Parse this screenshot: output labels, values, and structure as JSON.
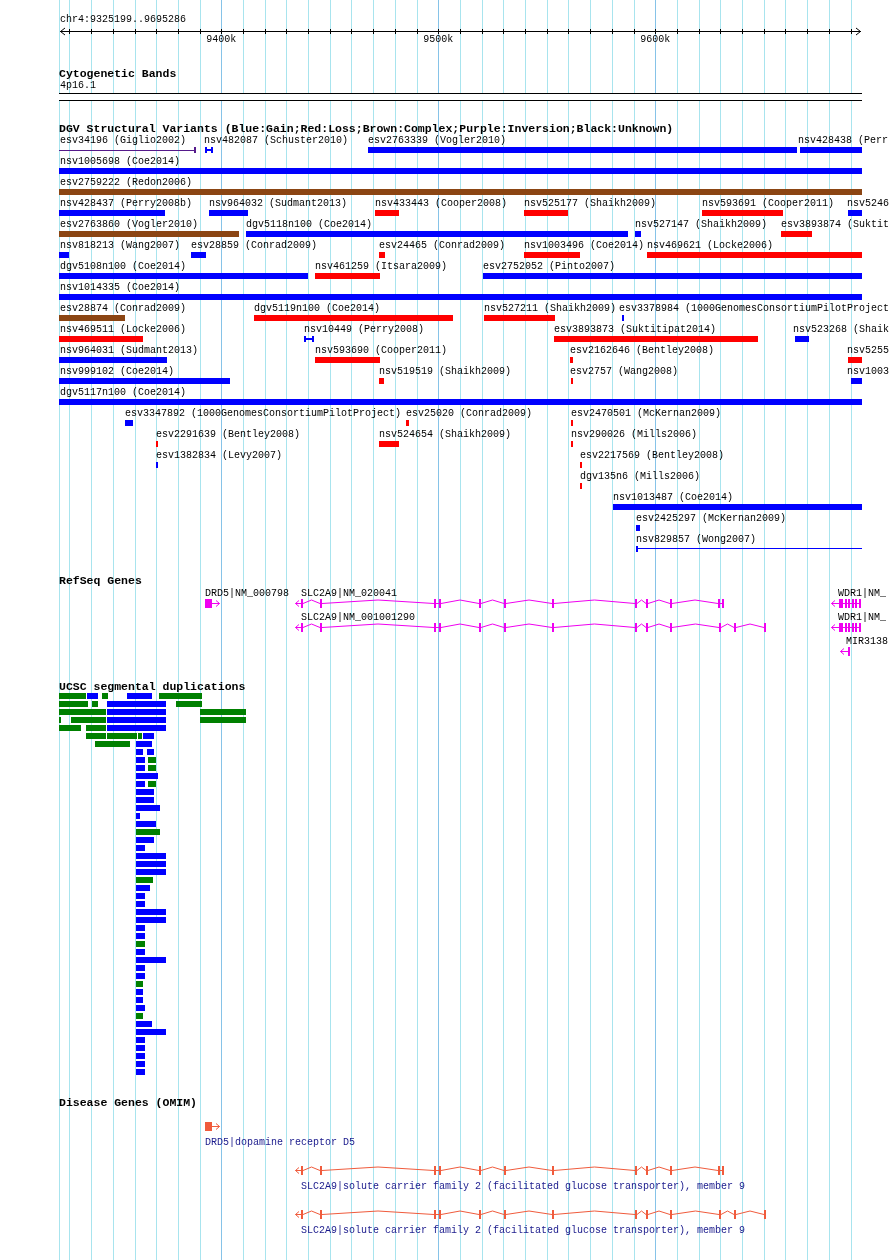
{
  "ruler": {
    "position": "chr4:9325199..9695286",
    "tick_labels": [
      "9400k",
      "9500k",
      "9600k"
    ]
  },
  "cytogenetic_bands": {
    "title": "Cytogenetic Bands",
    "bands": [
      {
        "label": "4p16.1"
      }
    ]
  },
  "dgv_structural_variants": {
    "title": "DGV Structural Variants (Blue:Gain;Red:Loss;Brown:Complex;Purple:Inversion;Black:Unknown)",
    "rows": [
      {
        "features": [
          {
            "label": "esv34196 (Giglio2002)",
            "color": "#551a8b"
          },
          {
            "label": "nsv482087 (Schuster2010)",
            "color": "#0000ff"
          },
          {
            "label": "esv2763339 (Vogler2010)",
            "color": "#0000ff"
          },
          {
            "label": "nsv428438 (Perr",
            "color": "#0000ff"
          }
        ]
      },
      {
        "features": [
          {
            "label": "nsv1005698 (Coe2014)",
            "color": "#0000ff"
          }
        ]
      },
      {
        "features": [
          {
            "label": "esv2759222 (Redon2006)",
            "color": "#8b4513"
          }
        ]
      },
      {
        "features": [
          {
            "label": "nsv428437 (Perry2008b)",
            "color": "#0000ff"
          },
          {
            "label": "nsv964032 (Sudmant2013)",
            "color": "#0000ff"
          },
          {
            "label": "nsv433443 (Cooper2008)",
            "color": "#ff0000"
          },
          {
            "label": "nsv525177 (Shaikh2009)",
            "color": "#ff0000"
          },
          {
            "label": "nsv593691 (Cooper2011)",
            "color": "#ff0000"
          },
          {
            "label": "nsv5246",
            "color": "#0000ff"
          }
        ]
      },
      {
        "features": [
          {
            "label": "esv2763860 (Vogler2010)",
            "color": "#8b4513"
          },
          {
            "label": "dgv5118n100 (Coe2014)",
            "color": "#0000ff"
          },
          {
            "label": "nsv527147 (Shaikh2009)",
            "color": "#0000ff"
          },
          {
            "label": "esv3893874 (Suktit",
            "color": "#ff0000"
          }
        ]
      },
      {
        "features": [
          {
            "label": "nsv818213 (Wang2007)",
            "color": "#0000ff"
          },
          {
            "label": "esv28859 (Conrad2009)",
            "color": "#0000ff"
          },
          {
            "label": "esv24465 (Conrad2009)",
            "color": "#ff0000"
          },
          {
            "label": "nsv1003496 (Coe2014)",
            "color": "#ff0000"
          },
          {
            "label": "nsv469621 (Locke2006)",
            "color": "#ff0000"
          }
        ]
      },
      {
        "features": [
          {
            "label": "dgv5108n100 (Coe2014)",
            "color": "#0000ff"
          },
          {
            "label": "nsv461259 (Itsara2009)",
            "color": "#ff0000"
          },
          {
            "label": "esv2752052 (Pinto2007)",
            "color": "#0000ff"
          }
        ]
      },
      {
        "features": [
          {
            "label": "nsv1014335 (Coe2014)",
            "color": "#0000ff"
          }
        ]
      },
      {
        "features": [
          {
            "label": "esv28874 (Conrad2009)",
            "color": "#8b4513"
          },
          {
            "label": "dgv5119n100 (Coe2014)",
            "color": "#ff0000"
          },
          {
            "label": "nsv527211 (Shaikh2009)",
            "color": "#ff0000"
          },
          {
            "label": "esv3378984 (1000GenomesConsortiumPilotProject",
            "color": "#0000ff"
          }
        ]
      },
      {
        "features": [
          {
            "label": "nsv469511 (Locke2006)",
            "color": "#ff0000"
          },
          {
            "label": "nsv10449 (Perry2008)",
            "color": "#0000ff"
          },
          {
            "label": "esv3893873 (Suktitipat2014)",
            "color": "#ff0000"
          },
          {
            "label": "nsv523268 (Shaik",
            "color": "#0000ff"
          }
        ]
      },
      {
        "features": [
          {
            "label": "nsv964031 (Sudmant2013)",
            "color": "#0000ff"
          },
          {
            "label": "nsv593690 (Cooper2011)",
            "color": "#ff0000"
          },
          {
            "label": "esv2162646 (Bentley2008)",
            "color": "#ff0000"
          },
          {
            "label": "nsv5255",
            "color": "#ff0000"
          }
        ]
      },
      {
        "features": [
          {
            "label": "nsv999102 (Coe2014)",
            "color": "#0000ff"
          },
          {
            "label": "nsv519519 (Shaikh2009)",
            "color": "#ff0000"
          },
          {
            "label": "esv2757 (Wang2008)",
            "color": "#ff0000"
          },
          {
            "label": "nsv1003",
            "color": "#0000ff"
          }
        ]
      },
      {
        "features": [
          {
            "label": "dgv5117n100 (Coe2014)",
            "color": "#0000ff"
          }
        ]
      },
      {
        "features": [
          {
            "label": "esv3347892 (1000GenomesConsortiumPilotProject)",
            "color": "#0000ff"
          },
          {
            "label": "esv25020 (Conrad2009)",
            "color": "#ff0000"
          },
          {
            "label": "esv2470501 (McKernan2009)",
            "color": "#ff0000"
          }
        ]
      },
      {
        "features": [
          {
            "label": "esv2291639 (Bentley2008)",
            "color": "#ff0000"
          },
          {
            "label": "nsv524654 (Shaikh2009)",
            "color": "#ff0000"
          },
          {
            "label": "nsv290026 (Mills2006)",
            "color": "#ff0000"
          }
        ]
      },
      {
        "features": [
          {
            "label": "esv1382834 (Levy2007)",
            "color": "#0000ff"
          },
          {
            "label": "esv2217569 (Bentley2008)",
            "color": "#ff0000"
          }
        ]
      },
      {
        "features": [
          {
            "label": "dgv135n6 (Mills2006)",
            "color": "#ff0000"
          }
        ]
      },
      {
        "features": [
          {
            "label": "nsv1013487 (Coe2014)",
            "color": "#0000ff"
          }
        ]
      },
      {
        "features": [
          {
            "label": "esv2425297 (McKernan2009)",
            "color": "#0000ff"
          }
        ]
      },
      {
        "features": [
          {
            "label": "nsv829857 (Wong2007)",
            "color": "#0000ff"
          }
        ]
      }
    ]
  },
  "refseq_genes": {
    "title": "RefSeq Genes",
    "rows": [
      {
        "genes": [
          {
            "label": "DRD5|NM_000798"
          },
          {
            "label": "SLC2A9|NM_020041"
          },
          {
            "label": "WDR1|NM_"
          }
        ]
      },
      {
        "genes": [
          {
            "label": "SLC2A9|NM_001001290"
          },
          {
            "label": "WDR1|NM_"
          }
        ]
      },
      {
        "genes": [
          {
            "label": "MIR3138"
          }
        ]
      }
    ]
  },
  "segmental_duplications": {
    "title": "UCSC segmental duplications",
    "rows": [
      {
        "items": [
          {
            "color": "#008000"
          },
          {
            "color": "#0000ff"
          },
          {
            "color": "#008000"
          },
          {
            "color": "#0000ff"
          },
          {
            "color": "#008000"
          }
        ]
      },
      {
        "items": [
          {
            "color": "#008000"
          },
          {
            "color": "#008000"
          },
          {
            "color": "#0000ff"
          },
          {
            "color": "#008000"
          }
        ]
      },
      {
        "items": [
          {
            "color": "#008000"
          },
          {
            "color": "#0000ff"
          },
          {
            "color": "#008000"
          }
        ]
      },
      {
        "items": [
          {
            "color": "#008000"
          },
          {
            "color": "#008000"
          },
          {
            "color": "#0000ff"
          },
          {
            "color": "#008000"
          }
        ]
      },
      {
        "items": [
          {
            "color": "#008000"
          },
          {
            "color": "#008000"
          },
          {
            "color": "#0000ff"
          }
        ]
      },
      {
        "items": [
          {
            "color": "#008000"
          },
          {
            "color": "#008000"
          },
          {
            "color": "#008000"
          },
          {
            "color": "#0000ff"
          }
        ]
      },
      {
        "items": [
          {
            "color": "#008000"
          },
          {
            "color": "#0000ff"
          }
        ]
      },
      {
        "items": [
          {
            "color": "#0000ff"
          },
          {
            "color": "#0000ff"
          }
        ]
      },
      {
        "items": [
          {
            "color": "#0000ff"
          },
          {
            "color": "#008000"
          }
        ]
      },
      {
        "items": [
          {
            "color": "#0000ff"
          },
          {
            "color": "#008000"
          }
        ]
      },
      {
        "items": [
          {
            "color": "#0000ff"
          }
        ]
      },
      {
        "items": [
          {
            "color": "#0000ff"
          },
          {
            "color": "#008000"
          }
        ]
      },
      {
        "items": [
          {
            "color": "#0000ff"
          }
        ]
      },
      {
        "items": [
          {
            "color": "#0000ff"
          }
        ]
      },
      {
        "items": [
          {
            "color": "#0000ff"
          }
        ]
      },
      {
        "items": [
          {
            "color": "#0000ff"
          }
        ]
      },
      {
        "items": [
          {
            "color": "#0000ff"
          }
        ]
      },
      {
        "items": [
          {
            "color": "#008000"
          }
        ]
      },
      {
        "items": [
          {
            "color": "#0000ff"
          }
        ]
      },
      {
        "items": [
          {
            "color": "#0000ff"
          }
        ]
      },
      {
        "items": [
          {
            "color": "#0000ff"
          }
        ]
      },
      {
        "items": [
          {
            "color": "#0000ff"
          }
        ]
      },
      {
        "items": [
          {
            "color": "#0000ff"
          }
        ]
      },
      {
        "items": [
          {
            "color": "#008000"
          }
        ]
      },
      {
        "items": [
          {
            "color": "#0000ff"
          }
        ]
      },
      {
        "items": [
          {
            "color": "#0000ff"
          }
        ]
      },
      {
        "items": [
          {
            "color": "#0000ff"
          }
        ]
      },
      {
        "items": [
          {
            "color": "#0000ff"
          }
        ]
      },
      {
        "items": [
          {
            "color": "#0000ff"
          }
        ]
      },
      {
        "items": [
          {
            "color": "#0000ff"
          }
        ]
      },
      {
        "items": [
          {
            "color": "#0000ff"
          }
        ]
      },
      {
        "items": [
          {
            "color": "#008000"
          }
        ]
      },
      {
        "items": [
          {
            "color": "#0000ff"
          }
        ]
      },
      {
        "items": [
          {
            "color": "#0000ff"
          }
        ]
      },
      {
        "items": [
          {
            "color": "#0000ff"
          }
        ]
      },
      {
        "items": [
          {
            "color": "#0000ff"
          }
        ]
      },
      {
        "items": [
          {
            "color": "#008000"
          }
        ]
      },
      {
        "items": [
          {
            "color": "#0000ff"
          }
        ]
      },
      {
        "items": [
          {
            "color": "#0000ff"
          }
        ]
      },
      {
        "items": [
          {
            "color": "#0000ff"
          }
        ]
      },
      {
        "items": [
          {
            "color": "#008000"
          }
        ]
      },
      {
        "items": [
          {
            "color": "#0000ff"
          }
        ]
      },
      {
        "items": [
          {
            "color": "#0000ff"
          }
        ]
      },
      {
        "items": [
          {
            "color": "#0000ff"
          }
        ]
      },
      {
        "items": [
          {
            "color": "#0000ff"
          }
        ]
      },
      {
        "items": [
          {
            "color": "#0000ff"
          }
        ]
      },
      {
        "items": [
          {
            "color": "#0000ff"
          }
        ]
      },
      {
        "items": [
          {
            "color": "#0000ff"
          }
        ]
      }
    ]
  },
  "disease_genes": {
    "title": "Disease Genes (OMIM)",
    "genes": [
      {
        "label": "DRD5|dopamine receptor D5"
      },
      {
        "label": "SLC2A9|solute carrier family 2 (facilitated glucose transporter), member 9"
      },
      {
        "label": "SLC2A9|solute carrier family 2 (facilitated glucose transporter), member 9"
      }
    ]
  }
}
